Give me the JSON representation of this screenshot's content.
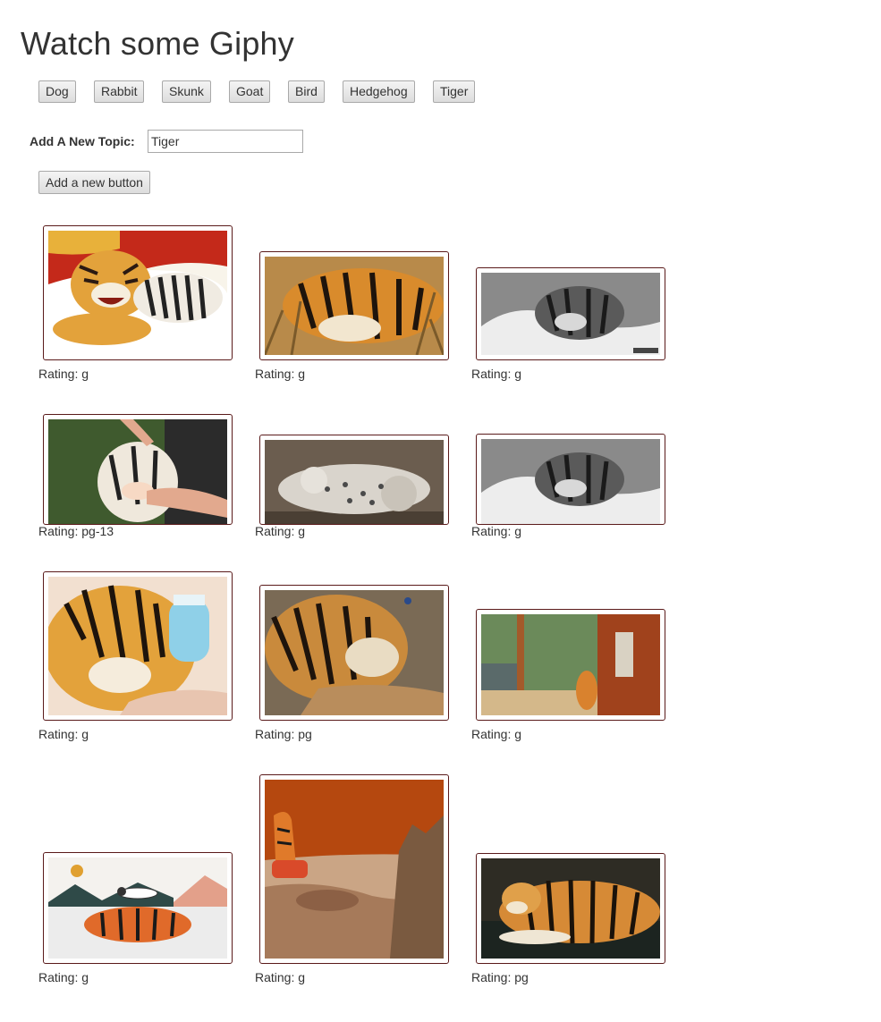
{
  "page": {
    "title": "Watch some Giphy"
  },
  "topics": [
    "Dog",
    "Rabbit",
    "Skunk",
    "Goat",
    "Bird",
    "Hedgehog",
    "Tiger"
  ],
  "form": {
    "label": "Add A New Topic:",
    "input_value": "Tiger",
    "button_label": "Add a new button"
  },
  "gifs": [
    {
      "rating": "Rating: g",
      "scene": "tiger-snarling-on-boat"
    },
    {
      "rating": "Rating: g",
      "scene": "tiger-resting-in-grass"
    },
    {
      "rating": "Rating: g",
      "scene": "tiger-cub-grayscale"
    },
    {
      "rating": "Rating: pg-13",
      "scene": "tiger-cub-petted-by-hands"
    },
    {
      "rating": "Rating: g",
      "scene": "snow-leopard-rolling"
    },
    {
      "rating": "Rating: g",
      "scene": "tiger-cub-grayscale"
    },
    {
      "rating": "Rating: g",
      "scene": "tiger-cub-bottle-feeding"
    },
    {
      "rating": "Rating: pg",
      "scene": "tiger-face-closeup"
    },
    {
      "rating": "Rating: g",
      "scene": "tiger-cub-zoo-enclosure"
    },
    {
      "rating": "Rating: g",
      "scene": "illustrated-woman-on-tiger"
    },
    {
      "rating": "Rating: g",
      "scene": "tiger-astronaut-on-mars"
    },
    {
      "rating": "Rating: pg",
      "scene": "tiger-lying-in-water"
    }
  ]
}
